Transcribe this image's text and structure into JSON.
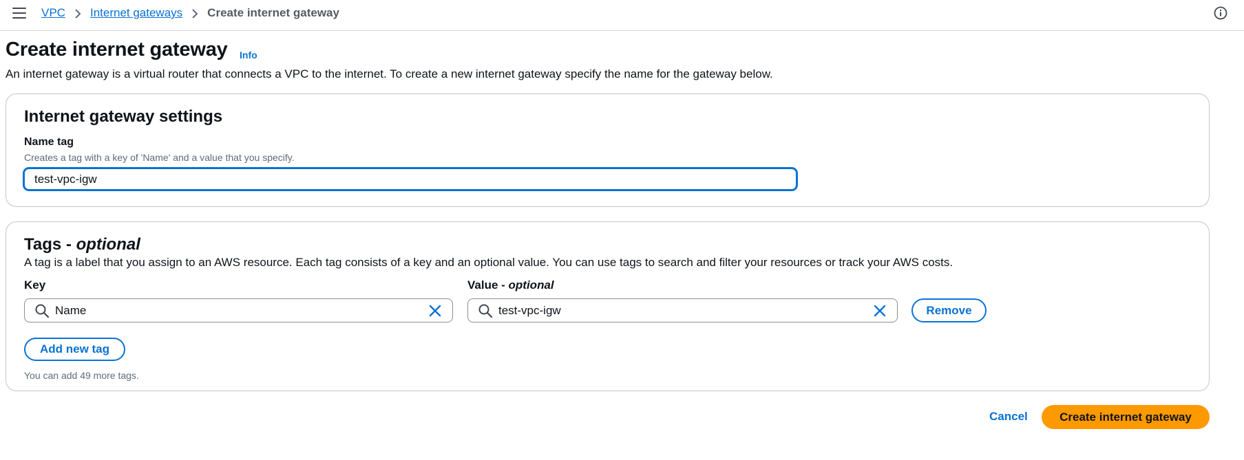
{
  "breadcrumb": {
    "items": [
      "VPC",
      "Internet gateways"
    ],
    "current": "Create internet gateway"
  },
  "page": {
    "title": "Create internet gateway",
    "info_label": "Info",
    "description": "An internet gateway is a virtual router that connects a VPC to the internet. To create a new internet gateway specify the name for the gateway below."
  },
  "settings": {
    "heading": "Internet gateway settings",
    "name_tag_label": "Name tag",
    "name_tag_description": "Creates a tag with a key of 'Name' and a value that you specify.",
    "name_tag_value": "test-vpc-igw"
  },
  "tags": {
    "heading_main": "Tags - ",
    "heading_optional": "optional",
    "description": "A tag is a label that you assign to an AWS resource. Each tag consists of a key and an optional value. You can use tags to search and filter your resources or track your AWS costs.",
    "key_label": "Key",
    "value_label_main": "Value - ",
    "value_label_optional": "optional",
    "rows": [
      {
        "key": "Name",
        "value": "test-vpc-igw",
        "remove_label": "Remove"
      }
    ],
    "add_label": "Add new tag",
    "limit_text": "You can add 49 more tags."
  },
  "actions": {
    "cancel_label": "Cancel",
    "submit_label": "Create internet gateway"
  },
  "colors": {
    "link": "#0972d3",
    "primary_button": "#ff9900",
    "border": "#c6c6cd"
  }
}
